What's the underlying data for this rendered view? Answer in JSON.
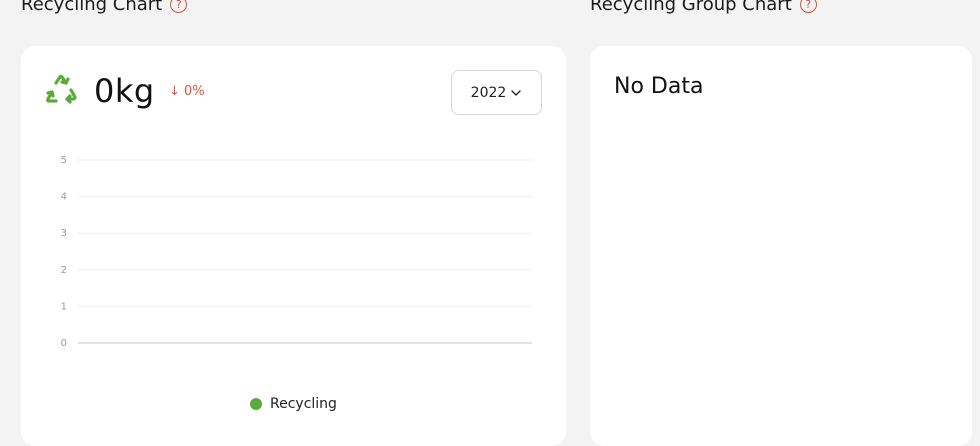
{
  "left_section": {
    "title": "Recycling Chart",
    "help_glyph": "?"
  },
  "right_section": {
    "title": "Recycling Group Chart",
    "help_glyph": "?",
    "empty_text": "No Data"
  },
  "summary": {
    "value": "0kg",
    "change": "↓ 0%",
    "change_color": "#e0503c"
  },
  "year_select": {
    "value": "2022"
  },
  "legend": {
    "label": "Recycling",
    "color": "#5aaa3c"
  },
  "chart_data": {
    "type": "line",
    "series": [
      {
        "name": "Recycling",
        "values": []
      }
    ],
    "y_ticks": [
      "0",
      "1",
      "2",
      "3",
      "4",
      "5"
    ],
    "ylim": [
      0,
      5
    ],
    "grid": true,
    "legend_placement": "bottom-center"
  },
  "colors": {
    "accent_green": "#5aaa3c",
    "accent_red": "#e0503c"
  }
}
